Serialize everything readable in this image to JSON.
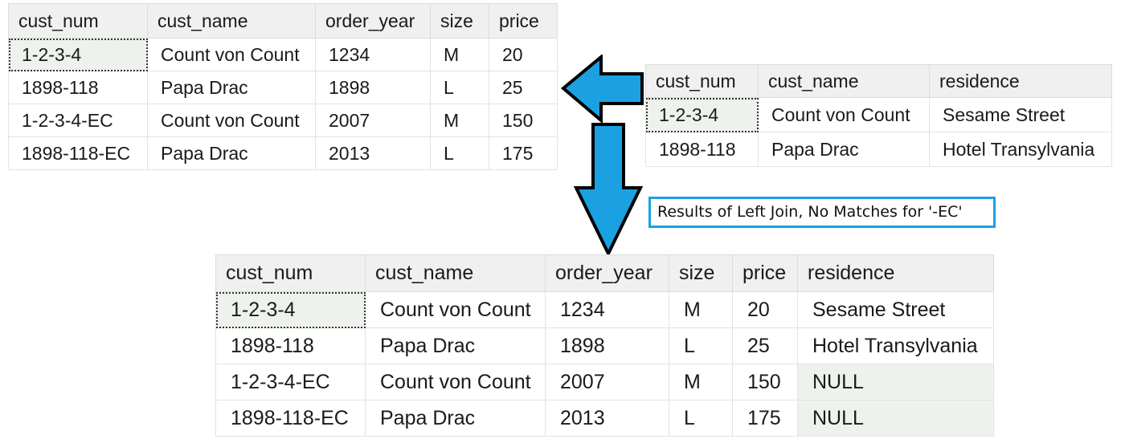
{
  "orders": {
    "columns": [
      "cust_num",
      "cust_name",
      "order_year",
      "size",
      "price"
    ],
    "rows": [
      [
        "1-2-3-4",
        "Count von Count",
        "1234",
        "M",
        "20"
      ],
      [
        "1898-118",
        "Papa Drac",
        "1898",
        "L",
        "25"
      ],
      [
        "1-2-3-4-EC",
        "Count von Count",
        "2007",
        "M",
        "150"
      ],
      [
        "1898-118-EC",
        "Papa Drac",
        "2013",
        "L",
        "175"
      ]
    ]
  },
  "customers": {
    "columns": [
      "cust_num",
      "cust_name",
      "residence"
    ],
    "rows": [
      [
        "1-2-3-4",
        "Count von Count",
        "Sesame Street"
      ],
      [
        "1898-118",
        "Papa Drac",
        "Hotel Transylvania"
      ]
    ]
  },
  "result": {
    "columns": [
      "cust_num",
      "cust_name",
      "order_year",
      "size",
      "price",
      "residence"
    ],
    "rows": [
      [
        "1-2-3-4",
        "Count von Count",
        "1234",
        "M",
        "20",
        "Sesame Street"
      ],
      [
        "1898-118",
        "Papa Drac",
        "1898",
        "L",
        "25",
        "Hotel Transylvania"
      ],
      [
        "1-2-3-4-EC",
        "Count von Count",
        "2007",
        "M",
        "150",
        "NULL"
      ],
      [
        "1898-118-EC",
        "Papa Drac",
        "2013",
        "L",
        "175",
        "NULL"
      ]
    ]
  },
  "note": {
    "text": "Results of Left Join, No Matches for '-EC'"
  },
  "colors": {
    "arrow_fill": "#1ba1e2",
    "arrow_stroke": "#000000",
    "note_border": "#1ba1e2",
    "null_cell": "#eef2ec"
  },
  "icons": [
    "arrow-left-icon",
    "arrow-down-icon"
  ]
}
